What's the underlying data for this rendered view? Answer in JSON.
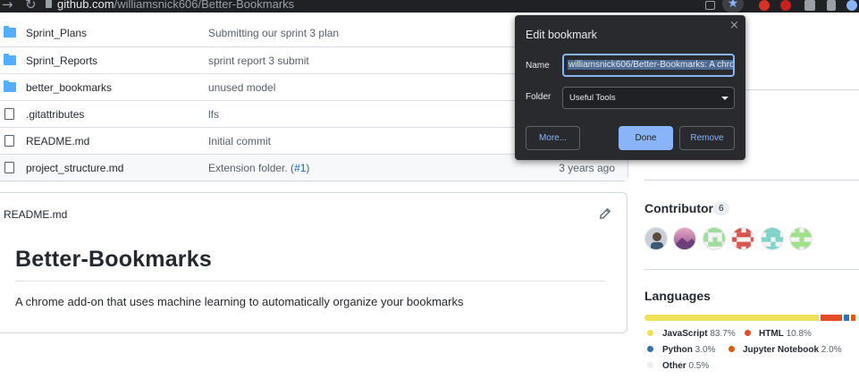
{
  "browser": {
    "url_host": "github.com",
    "url_path": "/williamsnick606/Better-Bookmarks"
  },
  "files": [
    {
      "name": "Sprint_Plans",
      "type": "folder",
      "message": "Submitting our sprint 3 plan",
      "age": ""
    },
    {
      "name": "Sprint_Reports",
      "type": "folder",
      "message": "sprint report 3 submit",
      "age": ""
    },
    {
      "name": "better_bookmarks",
      "type": "folder",
      "message": "unused model",
      "age": ""
    },
    {
      "name": ".gitattributes",
      "type": "file",
      "message": "lfs",
      "age": ""
    },
    {
      "name": "README.md",
      "type": "file",
      "message": "Initial commit",
      "age": ""
    },
    {
      "name": "project_structure.md",
      "type": "file",
      "message": "Extension folder. (",
      "message_link": "#1",
      "message_end": ")",
      "age": "3 years ago"
    }
  ],
  "readme": {
    "header": "README.md",
    "title": "Better-Bookmarks",
    "description": "A chrome add-on that uses machine learning to automatically organize your bookmarks"
  },
  "contributors": {
    "title": "Contributors",
    "count": "6"
  },
  "languages": {
    "title": "Languages",
    "items": [
      {
        "name": "JavaScript",
        "pct": "83.7%",
        "color": "#f1e05a"
      },
      {
        "name": "HTML",
        "pct": "10.8%",
        "color": "#e34c26"
      },
      {
        "name": "Python",
        "pct": "3.0%",
        "color": "#3572A5"
      },
      {
        "name": "Jupyter Notebook",
        "pct": "2.0%",
        "color": "#DA5B0B"
      },
      {
        "name": "Other",
        "pct": "0.5%",
        "color": "#ededed"
      }
    ]
  },
  "bookmark_popup": {
    "title": "Edit bookmark",
    "close": "×",
    "name_label": "Name",
    "name_value": "williamsnick606/Better-Bookmarks: A chro",
    "folder_label": "Folder",
    "folder_value": "Useful Tools",
    "more_label": "More...",
    "done_label": "Done",
    "remove_label": "Remove"
  }
}
